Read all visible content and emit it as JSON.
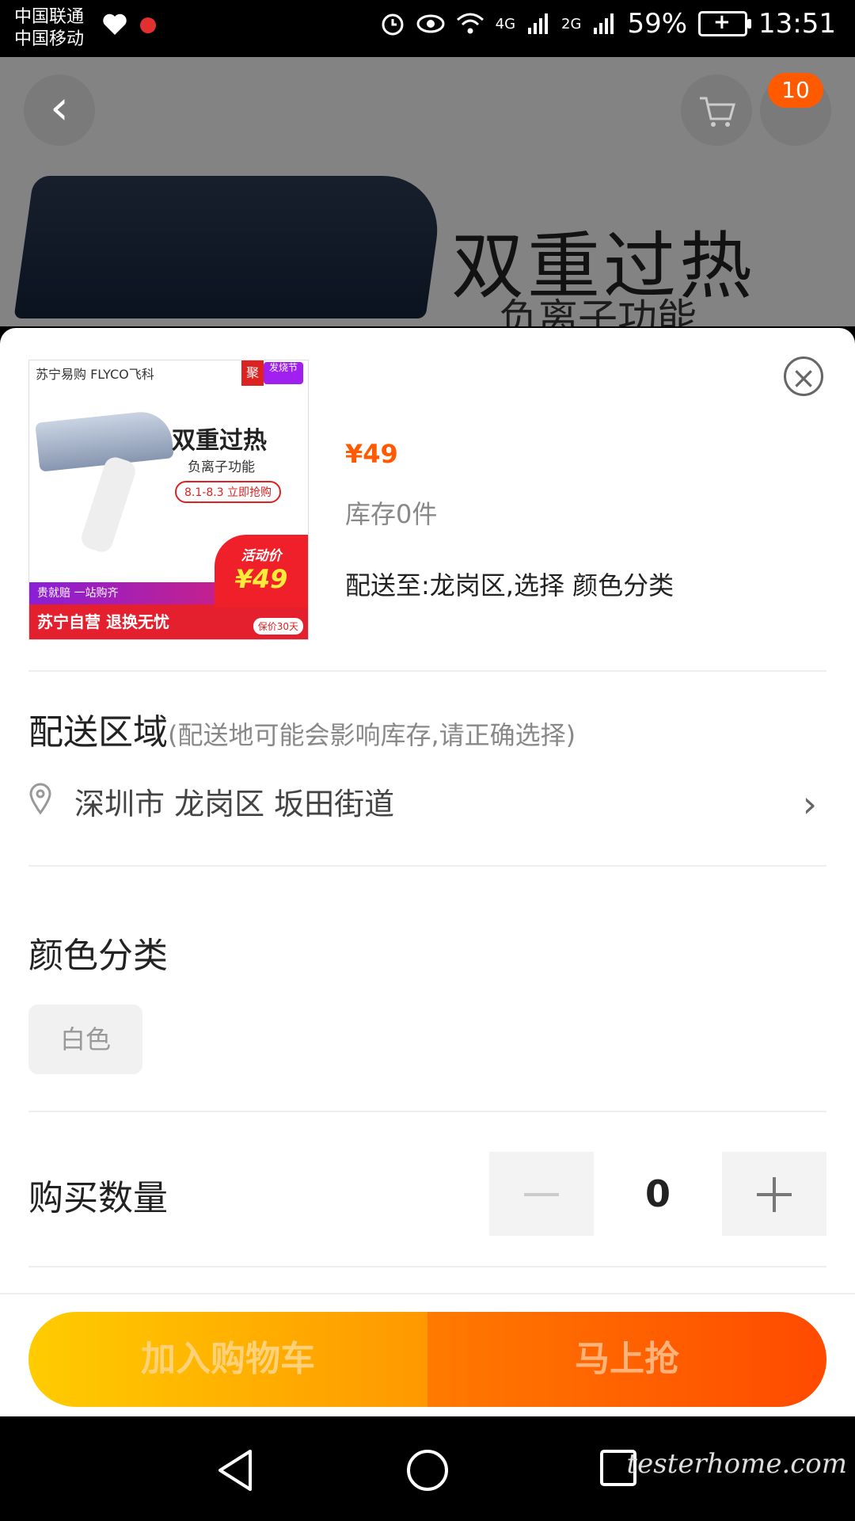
{
  "status_bar": {
    "carrier_1": "中国联通",
    "carrier_2": "中国移动",
    "net_4g": "4G",
    "net_2g": "2G",
    "battery": "59%",
    "time": "13:51"
  },
  "background": {
    "badge_count": "10",
    "banner_title": "双重过热",
    "banner_subtitle": "负离子功能"
  },
  "product": {
    "thumb": {
      "store": "苏宁易购 FLYCO飞科",
      "tag": "聚",
      "tag2": "发烧节",
      "title": "双重过热",
      "subtitle": "负离子功能",
      "date": "8.1-8.3 立即抢购",
      "band": "贵就赔 一站购齐",
      "bottom": "苏宁自营 退换无忧",
      "activity_label": "活动价",
      "activity_price": "¥49",
      "guarantee": "保价30天"
    },
    "price": "¥49",
    "stock": "库存0件",
    "delivery_info": "配送至:龙岗区,选择 颜色分类"
  },
  "delivery": {
    "title": "配送区域",
    "hint": "(配送地可能会影响库存,请正确选择)",
    "address": "深圳市 龙岗区 坂田街道"
  },
  "color": {
    "title": "颜色分类",
    "options": [
      "白色"
    ]
  },
  "quantity": {
    "label": "购买数量",
    "value": "0"
  },
  "actions": {
    "add_to_cart": "加入购物车",
    "buy_now": "马上抢"
  },
  "watermark": "testerhome.com",
  "colors": {
    "accent": "#ff5a00",
    "cart_gradient": [
      "#ffcc00",
      "#ff9800"
    ],
    "buy_gradient": [
      "#ff7a00",
      "#ff4a00"
    ]
  }
}
